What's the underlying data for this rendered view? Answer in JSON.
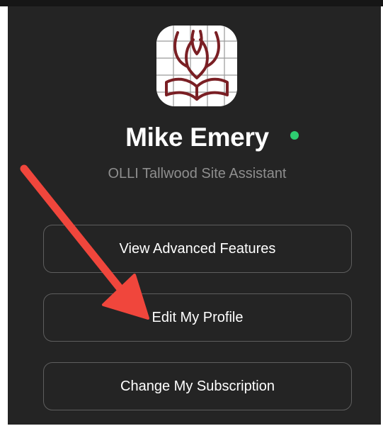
{
  "profile": {
    "name": "Mike Emery",
    "title": "OLLI Tallwood Site Assistant",
    "status": "online",
    "status_color": "#2ecc71",
    "avatar_icon": "dove-book-logo-icon"
  },
  "menu": {
    "items": [
      {
        "label": "View Advanced Features"
      },
      {
        "label": "Edit My Profile"
      },
      {
        "label": "Change My Subscription"
      }
    ]
  },
  "annotation": {
    "arrow_color": "#f0463c",
    "target": "Edit My Profile"
  },
  "theme": {
    "panel_background": "#242424",
    "button_border": "#5e5e5e",
    "subtitle_color": "#8e8e8e"
  }
}
